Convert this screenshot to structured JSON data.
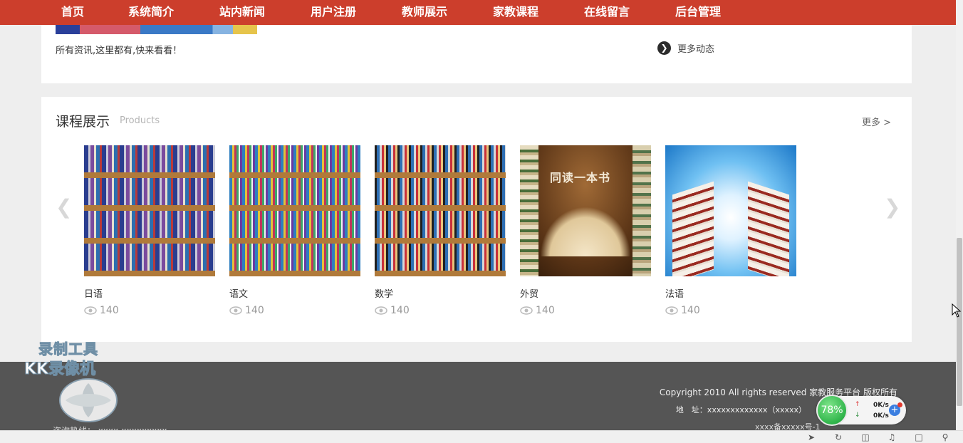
{
  "nav": {
    "items": [
      "首页",
      "系统简介",
      "站内新闻",
      "用户注册",
      "教师展示",
      "家教课程",
      "在线留言",
      "后台管理"
    ]
  },
  "news": {
    "description": "所有资讯,这里都有,快来看看！",
    "more_label": "更多动态"
  },
  "products": {
    "title": "课程展示",
    "subtitle": "Products",
    "more_label": "更多 >",
    "items": [
      {
        "name": "日语",
        "views": "140"
      },
      {
        "name": "语文",
        "views": "140"
      },
      {
        "name": "数学",
        "views": "140"
      },
      {
        "name": "外贸",
        "views": "140",
        "image_caption": "同读一本书"
      },
      {
        "name": "法语",
        "views": "140"
      }
    ]
  },
  "footer": {
    "copyright": "Copyright 2010 All rights reserved 家教服务平台 版权所有",
    "address": "地　址：xxxxxxxxxxxxx（xxxxx）",
    "icp": "xxxx备xxxxx号-1",
    "hotline": "咨询热线： xxxx-xxxxxxxxx"
  },
  "watermark": {
    "line1": "录制工具",
    "line2": "KK录像机"
  },
  "speed_widget": {
    "percent": "78%",
    "upload": "0K/s",
    "download": "0K/s"
  },
  "colors": {
    "nav_bg": "#cc3e2c",
    "footer_bg": "#555555",
    "page_bg": "#eeeeee"
  }
}
